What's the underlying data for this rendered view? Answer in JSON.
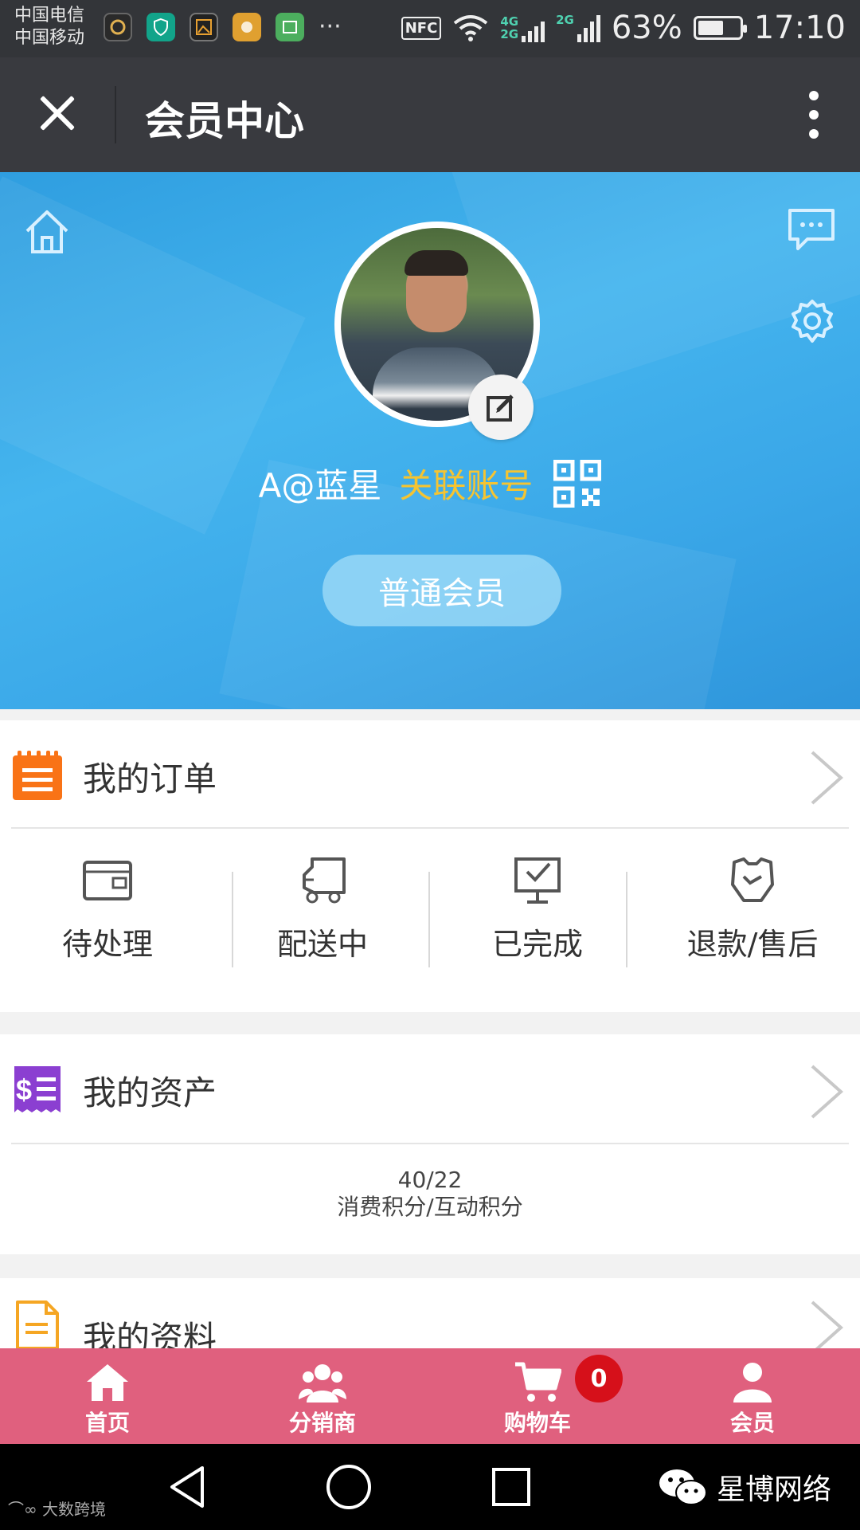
{
  "status_bar": {
    "carrier_1": "中国电信",
    "carrier_2": "中国移动",
    "nfc": "NFC",
    "net_top": "4G",
    "net_bottom": "2G",
    "net_2": "2G",
    "battery": "63%",
    "battery_level": 0.63,
    "time": "17:10",
    "more": "···"
  },
  "title_bar": {
    "title": "会员中心"
  },
  "profile": {
    "username": "A@蓝星",
    "link_account": "关联账号",
    "member_level": "普通会员",
    "accent": "#f5c431"
  },
  "orders": {
    "title": "我的订单",
    "items": [
      {
        "label": "待处理",
        "icon": "wallet-icon"
      },
      {
        "label": "配送中",
        "icon": "truck-icon"
      },
      {
        "label": "已完成",
        "icon": "check-monitor-icon"
      },
      {
        "label": "退款/售后",
        "icon": "refund-icon"
      }
    ]
  },
  "assets": {
    "title": "我的资产",
    "points_value": "40/22",
    "points_label": "消费积分/互动积分"
  },
  "profile_data": {
    "title": "我的资料"
  },
  "bottom_nav": {
    "items": [
      {
        "label": "首页"
      },
      {
        "label": "分销商"
      },
      {
        "label": "购物车"
      },
      {
        "label": "会员"
      }
    ],
    "cart_count": "0",
    "bg": "#e0607e"
  },
  "watermark": {
    "left": "大数跨境",
    "right": "星博网络"
  }
}
